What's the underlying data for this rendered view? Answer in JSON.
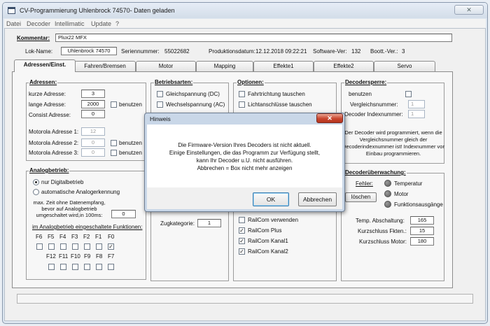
{
  "window": {
    "title": "CV-Programmierung Uhlenbrock  74570- Daten geladen",
    "close_symbol": "✕"
  },
  "menu": [
    "Datei",
    "Decoder",
    "Intellimatic",
    "Update",
    "?"
  ],
  "header": {
    "kommentar_label": "Kommentar:",
    "kommentar_value": "Plux22 MFX",
    "lok_name_label": "Lok-Name:",
    "lok_name_value": "Uhlenbrock 74570",
    "seriennummer_label": "Seriennummer:",
    "seriennummer_value": "55022682",
    "produktionsdatum_label": "Produktionsdatum:",
    "produktionsdatum_value": "12.12.2018 09:22:21",
    "software_label": "Software-Ver:",
    "software_value": "132",
    "boot_label": "Boott.-Ver.:",
    "boot_value": "3"
  },
  "tabs": [
    "Adressen/Einst.",
    "Fahren/Bremsen",
    "Motor",
    "Mapping",
    "Effekte1",
    "Effekte2",
    "Servo"
  ],
  "adressen": {
    "title": "Adressen:",
    "kurze_label": "kurze Adresse:",
    "kurze_value": "3",
    "lange_label": "lange Adresse:",
    "lange_value": "2000",
    "benutzen": "benutzen",
    "consist_label": "Consist Adresse:",
    "consist_value": "0",
    "mm1_label": "Motorola Adresse 1:",
    "mm1_value": "12",
    "mm2_label": "Motorola Adresse 2:",
    "mm2_value": "0",
    "mm3_label": "Motorola Adresse 3:",
    "mm3_value": "0"
  },
  "betriebsarten": {
    "title": "Betriebsarten:",
    "dc": "Gleichspannung (DC)",
    "ac": "Wechselspannung (AC)"
  },
  "optionen": {
    "title": "Optionen:",
    "fahrtrichtung": "Fahrtrichtung tauschen",
    "licht": "Lichtanschlüsse tauschen",
    "railcom_verw": "RailCom verwenden",
    "railcom_plus": "RailCom Plus",
    "kanal1": "RailCom Kanal1",
    "kanal2": "RailCom Kanal2"
  },
  "decodersperre": {
    "title": "Decodersperre:",
    "benutzen": "benutzen",
    "vergleich_label": "Vergleichsnummer:",
    "vergleich_value": "1",
    "index_label": "Decoder Indexnummer:",
    "index_value": "1",
    "info": "Der Decoder wird programmiert, wenn die Vergleichsnummer gleich der Decoderindexnummer ist! Indexnummer vor Einbau programmieren."
  },
  "analog": {
    "title": "Analogbetrieb:",
    "nur_digital": "nur Digitalbetrieb",
    "auto": "automatische Analogerkennung",
    "zeit_text": "max. Zeit ohne Datenempfang, bevor auf Analogbetrieb umgeschaltet wird,in 100ms:",
    "zeit_value": "0",
    "funk_title": "im Analogbetrieb eingeschaltete Funktionen:",
    "row1": [
      "F6",
      "F5",
      "F4",
      "F3",
      "F2",
      "F1",
      "F0"
    ],
    "row2": [
      "F12",
      "F11",
      "F10",
      "F9",
      "F8",
      "F7"
    ]
  },
  "zugkategorie": {
    "label": "Zugkategorie:",
    "value": "1"
  },
  "ueberwachung": {
    "title": "Decoderüberwachung:",
    "fehler": "Fehler:",
    "loeschen": "löschen",
    "temperatur": "Temperatur",
    "motor": "Motor",
    "funktionsausgaenge": "Funktionsausgänge",
    "temp_label": "Temp. Abschaltung:",
    "temp_value": "165",
    "kurz_fkten_label": "Kurzschluss Fkten.:",
    "kurz_fkten_value": "15",
    "kurz_motor_label": "Kurzschluss Motor:",
    "kurz_motor_value": "180"
  },
  "dialog": {
    "title": "Hinweis",
    "close_symbol": "✕",
    "line1": "Die Firmware-Version Ihres Decoders ist nicht aktuell.",
    "line2": "Einige Einstellungen, die das Programm zur Verfügung stellt,",
    "line3": "kann Ihr Decoder u.U. nicht ausführen.",
    "line4": "Abbrechen = Box nicht mehr anzeigen",
    "ok": "OK",
    "abbrechen": "Abbrechen"
  },
  "colors": {
    "window_frame": "#dde6f0",
    "dialog_close": "#c9452d",
    "ok_border": "#3c7fb1"
  }
}
